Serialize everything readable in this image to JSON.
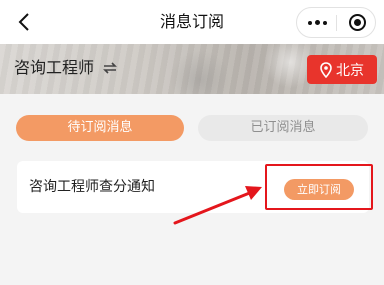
{
  "navbar": {
    "title": "消息订阅",
    "back_icon": "chevron-left-icon",
    "more_icon": "more-dots-icon",
    "close_icon": "target-circle-icon"
  },
  "banner": {
    "title": "咨询工程师",
    "switch_icon": "swap-arrows-icon",
    "city": "北京",
    "city_icon": "location-pin-icon"
  },
  "tabs": [
    {
      "label": "待订阅消息",
      "active": true
    },
    {
      "label": "已订阅消息",
      "active": false
    }
  ],
  "messages": [
    {
      "title": "咨询工程师查分通知",
      "action": "立即订阅"
    }
  ],
  "colors": {
    "accent": "#f39a64",
    "city_red": "#e8342c",
    "annotation_red": "#e4161c"
  }
}
